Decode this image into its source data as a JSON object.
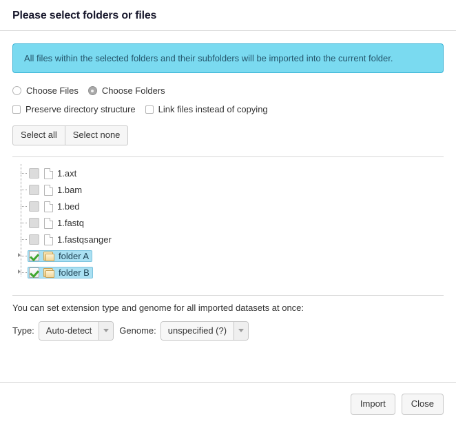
{
  "header": {
    "title": "Please select folders or files"
  },
  "banner": {
    "text": "All files within the selected folders and their subfolders will be imported into the current folder.",
    "bg_color": "#7adaf0",
    "border_color": "#3ab3d6"
  },
  "source_options": [
    {
      "label": "Choose Files",
      "type": "radio",
      "checked": false
    },
    {
      "label": "Choose Folders",
      "type": "radio",
      "checked": true
    }
  ],
  "flag_options": [
    {
      "label": "Preserve directory structure",
      "type": "checkbox",
      "checked": false
    },
    {
      "label": "Link files instead of copying",
      "type": "checkbox",
      "checked": false
    }
  ],
  "selection_buttons": {
    "select_all": "Select all",
    "select_none": "Select none"
  },
  "tree": {
    "rows": [
      {
        "label": "1.axt",
        "icon": "file-icon",
        "checkbox": "disabled",
        "selected": false,
        "expandable": false
      },
      {
        "label": "1.bam",
        "icon": "file-icon",
        "checkbox": "disabled",
        "selected": false,
        "expandable": false
      },
      {
        "label": "1.bed",
        "icon": "file-icon",
        "checkbox": "disabled",
        "selected": false,
        "expandable": false
      },
      {
        "label": "1.fastq",
        "icon": "file-icon",
        "checkbox": "disabled",
        "selected": false,
        "expandable": false
      },
      {
        "label": "1.fastqsanger",
        "icon": "file-icon",
        "checkbox": "disabled",
        "selected": false,
        "expandable": false
      },
      {
        "label": "folder A",
        "icon": "folder-icon",
        "checkbox": "checked",
        "selected": true,
        "expandable": true
      },
      {
        "label": "folder B",
        "icon": "folder-icon",
        "checkbox": "checked",
        "selected": true,
        "expandable": true
      }
    ],
    "selected_row_bg": "#aae0f2"
  },
  "settings": {
    "note": "You can set extension type and genome for all imported datasets at once:",
    "type_label": "Type:",
    "type_value": "Auto-detect",
    "genome_label": "Genome:",
    "genome_value": "unspecified (?)"
  },
  "footer": {
    "import_label": "Import",
    "close_label": "Close"
  }
}
